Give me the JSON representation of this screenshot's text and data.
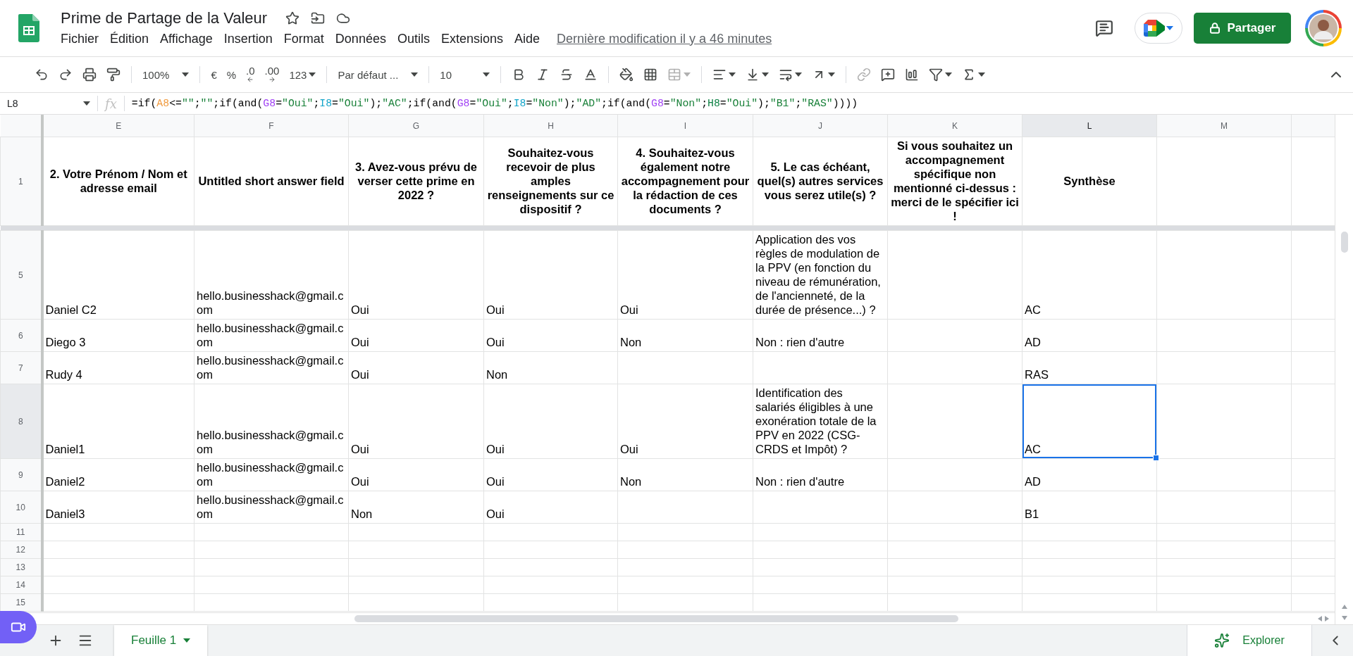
{
  "document": {
    "title": "Prime de Partage de la Valeur",
    "menus": [
      "Fichier",
      "Édition",
      "Affichage",
      "Insertion",
      "Format",
      "Données",
      "Outils",
      "Extensions",
      "Aide"
    ],
    "last_edit": "Dernière modification il y a 46 minutes"
  },
  "share_button": "Partager",
  "toolbar": {
    "zoom": "100%",
    "currency": "€",
    "percent": "%",
    "decrease_decimals": ".0",
    "increase_decimals": ".00",
    "number_format": "123",
    "font": "Par défaut ...",
    "font_size": "10"
  },
  "formula_bar": {
    "name_box": "L8",
    "fx": "fx",
    "formula": [
      {
        "text": "=if("
      },
      {
        "text": "A8",
        "color": "#f09a3e"
      },
      {
        "text": "<="
      },
      {
        "text": "\"\"",
        "color": "#188038"
      },
      {
        "text": ";"
      },
      {
        "text": "\"\"",
        "color": "#188038"
      },
      {
        "text": ";if(and("
      },
      {
        "text": "G8",
        "color": "#a142f4"
      },
      {
        "text": "="
      },
      {
        "text": "\"Oui\"",
        "color": "#188038"
      },
      {
        "text": ";"
      },
      {
        "text": "I8",
        "color": "#12a4c9"
      },
      {
        "text": "="
      },
      {
        "text": "\"Oui\"",
        "color": "#188038"
      },
      {
        "text": ");"
      },
      {
        "text": "\"AC\"",
        "color": "#188038"
      },
      {
        "text": ";if(and("
      },
      {
        "text": "G8",
        "color": "#a142f4"
      },
      {
        "text": "="
      },
      {
        "text": "\"Oui\"",
        "color": "#188038"
      },
      {
        "text": ";"
      },
      {
        "text": "I8",
        "color": "#12a4c9"
      },
      {
        "text": "="
      },
      {
        "text": "\"Non\"",
        "color": "#188038"
      },
      {
        "text": ");"
      },
      {
        "text": "\"AD\"",
        "color": "#188038"
      },
      {
        "text": ";if(and("
      },
      {
        "text": "G8",
        "color": "#a142f4"
      },
      {
        "text": "="
      },
      {
        "text": "\"Non\"",
        "color": "#188038"
      },
      {
        "text": ";"
      },
      {
        "text": "H8",
        "color": "#0b8043"
      },
      {
        "text": "="
      },
      {
        "text": "\"Oui\"",
        "color": "#188038"
      },
      {
        "text": ");"
      },
      {
        "text": "\"B1\"",
        "color": "#188038"
      },
      {
        "text": ";"
      },
      {
        "text": "\"RAS\"",
        "color": "#188038"
      },
      {
        "text": "))))"
      }
    ]
  },
  "columns": [
    {
      "label": "E",
      "selected": false
    },
    {
      "label": "F",
      "selected": false
    },
    {
      "label": "G",
      "selected": false
    },
    {
      "label": "H",
      "selected": false
    },
    {
      "label": "I",
      "selected": false
    },
    {
      "label": "J",
      "selected": false
    },
    {
      "label": "K",
      "selected": false
    },
    {
      "label": "L",
      "selected": true
    },
    {
      "label": "M",
      "selected": false
    }
  ],
  "rows": [
    {
      "number": "1",
      "kind": "header",
      "selected": false,
      "cells": [
        "2. Votre Prénom / Nom et adresse email",
        "Untitled short answer field",
        "3. Avez-vous prévu de verser cette prime en 2022 ?",
        "Souhaitez-vous recevoir de plus amples renseignements sur ce dispositif ?",
        "4. Souhaitez-vous également notre accompagnement pour la rédaction de ces documents ?",
        "5. Le cas échéant, quel(s) autres services vous serez utile(s) ?",
        "Si vous souhaitez un accompagnement spécifique non mentionné ci-dessus : merci de le spécifier ici !",
        "Synthèse",
        null
      ]
    },
    {
      "number": "5",
      "kind": "data",
      "selected": false,
      "cells": [
        "Daniel C2",
        "hello.businesshack@gmail.com",
        "Oui",
        "Oui",
        "Oui",
        "Application des vos règles de modulation de la PPV (en fonction du niveau de rémunération, de l'ancienneté, de la durée de présence...) ?",
        null,
        "AC",
        null
      ]
    },
    {
      "number": "6",
      "kind": "data",
      "selected": false,
      "cells": [
        "Diego 3",
        "hello.businesshack@gmail.com",
        "Oui",
        "Oui",
        "Non",
        "Non : rien d'autre",
        null,
        "AD",
        null
      ]
    },
    {
      "number": "7",
      "kind": "data",
      "selected": false,
      "cells": [
        "Rudy 4",
        "hello.businesshack@gmail.com",
        "Oui",
        "Non",
        null,
        null,
        null,
        "RAS",
        null
      ]
    },
    {
      "number": "8",
      "kind": "data",
      "selected": true,
      "cells": [
        "Daniel1",
        "hello.businesshack@gmail.com",
        "Oui",
        "Oui",
        "Oui",
        "Identification des salariés éligibles à une exonération totale de la PPV en 2022 (CSG-CRDS et Impôt) ?",
        null,
        "AC",
        null
      ]
    },
    {
      "number": "9",
      "kind": "data",
      "selected": false,
      "cells": [
        "Daniel2",
        "hello.businesshack@gmail.com",
        "Oui",
        "Oui",
        "Non",
        "Non : rien d'autre",
        null,
        "AD",
        null
      ]
    },
    {
      "number": "10",
      "kind": "data",
      "selected": false,
      "cells": [
        "Daniel3",
        "hello.businesshack@gmail.com",
        "Non",
        "Oui",
        null,
        null,
        null,
        "B1",
        null
      ]
    },
    {
      "number": "11",
      "kind": "data",
      "selected": false,
      "cells": [
        null,
        null,
        null,
        null,
        null,
        null,
        null,
        null,
        null
      ]
    },
    {
      "number": "12",
      "kind": "data",
      "selected": false,
      "cells": [
        null,
        null,
        null,
        null,
        null,
        null,
        null,
        null,
        null
      ]
    },
    {
      "number": "13",
      "kind": "data",
      "selected": false,
      "cells": [
        null,
        null,
        null,
        null,
        null,
        null,
        null,
        null,
        null
      ]
    },
    {
      "number": "14",
      "kind": "data",
      "selected": false,
      "cells": [
        null,
        null,
        null,
        null,
        null,
        null,
        null,
        null,
        null
      ]
    },
    {
      "number": "15",
      "kind": "data",
      "selected": false,
      "cells": [
        null,
        null,
        null,
        null,
        null,
        null,
        null,
        null,
        null
      ]
    }
  ],
  "sheet_tabs": [
    {
      "label": "Feuille 1",
      "selected": true
    }
  ],
  "explore": "Explorer"
}
